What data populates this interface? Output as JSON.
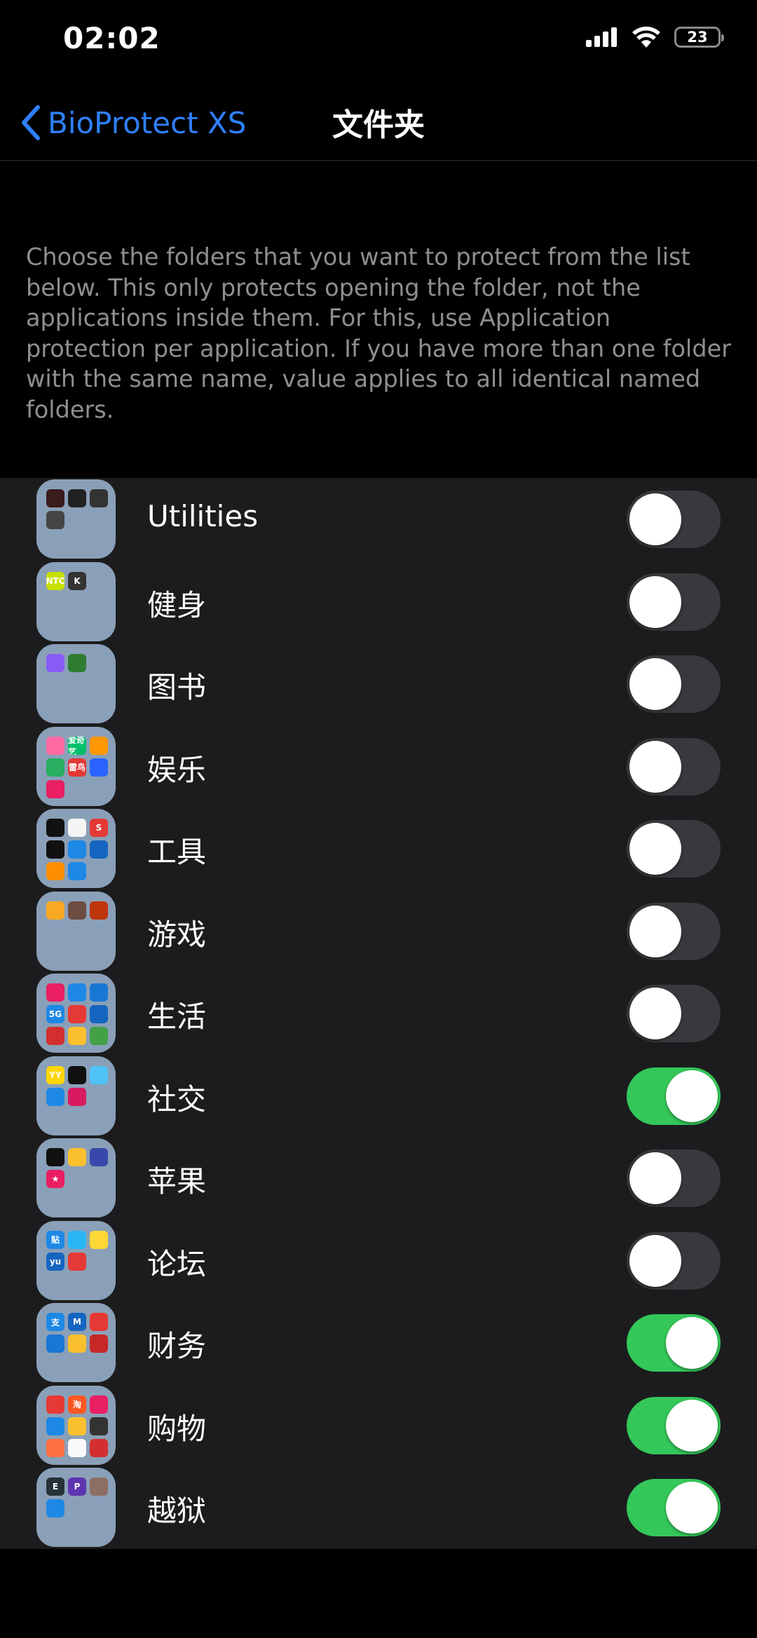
{
  "status_bar": {
    "time": "02:02",
    "battery": "23"
  },
  "nav": {
    "back_label": "BioProtect XS",
    "title": "文件夹"
  },
  "description": "Choose the folders that you want to protect from the list below. This only protects opening the folder, not the applications inside them. For this, use Application protection per application. If you have more than one folder with the same name, value applies to all identical named folders.",
  "colors": {
    "accent": "#2f80ff",
    "toggle_on": "#34c759",
    "toggle_off": "#39393d",
    "list_bg": "#1c1c1e"
  },
  "folders": [
    {
      "label": "Utilities",
      "on": false,
      "apps": [
        {
          "c": "#3a1c1c",
          "t": ""
        },
        {
          "c": "#222",
          "t": ""
        },
        {
          "c": "#333",
          "t": ""
        },
        {
          "c": "#444",
          "t": ""
        }
      ]
    },
    {
      "label": "健身",
      "on": false,
      "apps": [
        {
          "c": "#c8e000",
          "t": "NTC"
        },
        {
          "c": "#333",
          "t": "K"
        }
      ]
    },
    {
      "label": "图书",
      "on": false,
      "apps": [
        {
          "c": "#8a5cf6",
          "t": ""
        },
        {
          "c": "#2e7d32",
          "t": ""
        }
      ]
    },
    {
      "label": "娱乐",
      "on": false,
      "apps": [
        {
          "c": "#ff6aa2",
          "t": ""
        },
        {
          "c": "#00c06b",
          "t": "爱奇艺"
        },
        {
          "c": "#ff9800",
          "t": ""
        },
        {
          "c": "#27ae60",
          "t": ""
        },
        {
          "c": "#e53935",
          "t": "雷鸟"
        },
        {
          "c": "#2962ff",
          "t": ""
        },
        {
          "c": "#e91e63",
          "t": ""
        }
      ]
    },
    {
      "label": "工具",
      "on": false,
      "apps": [
        {
          "c": "#111",
          "t": ""
        },
        {
          "c": "#f5f5f5",
          "t": ""
        },
        {
          "c": "#e53935",
          "t": "S"
        },
        {
          "c": "#111",
          "t": ""
        },
        {
          "c": "#1e88e5",
          "t": ""
        },
        {
          "c": "#1565c0",
          "t": ""
        },
        {
          "c": "#ff8f00",
          "t": ""
        },
        {
          "c": "#1e88e5",
          "t": ""
        }
      ]
    },
    {
      "label": "游戏",
      "on": false,
      "apps": [
        {
          "c": "#f9a825",
          "t": ""
        },
        {
          "c": "#6d4c41",
          "t": ""
        },
        {
          "c": "#bf360c",
          "t": ""
        }
      ]
    },
    {
      "label": "生活",
      "on": false,
      "apps": [
        {
          "c": "#e91e63",
          "t": ""
        },
        {
          "c": "#1e88e5",
          "t": ""
        },
        {
          "c": "#1976d2",
          "t": ""
        },
        {
          "c": "#1e88e5",
          "t": "5G"
        },
        {
          "c": "#e53935",
          "t": ""
        },
        {
          "c": "#1565c0",
          "t": ""
        },
        {
          "c": "#d32f2f",
          "t": ""
        },
        {
          "c": "#fbc02d",
          "t": ""
        },
        {
          "c": "#43a047",
          "t": ""
        }
      ]
    },
    {
      "label": "社交",
      "on": true,
      "apps": [
        {
          "c": "#ffd600",
          "t": "YY"
        },
        {
          "c": "#111",
          "t": ""
        },
        {
          "c": "#4fc3f7",
          "t": ""
        },
        {
          "c": "#1e88e5",
          "t": ""
        },
        {
          "c": "#d81b60",
          "t": ""
        }
      ]
    },
    {
      "label": "苹果",
      "on": false,
      "apps": [
        {
          "c": "#111",
          "t": ""
        },
        {
          "c": "#fbc02d",
          "t": ""
        },
        {
          "c": "#3949ab",
          "t": ""
        },
        {
          "c": "#e91e63",
          "t": "★"
        }
      ]
    },
    {
      "label": "论坛",
      "on": false,
      "apps": [
        {
          "c": "#1e88e5",
          "t": "贴"
        },
        {
          "c": "#29b6f6",
          "t": ""
        },
        {
          "c": "#fdd835",
          "t": ""
        },
        {
          "c": "#1565c0",
          "t": "yu"
        },
        {
          "c": "#e53935",
          "t": ""
        }
      ]
    },
    {
      "label": "财务",
      "on": true,
      "apps": [
        {
          "c": "#1e88e5",
          "t": "支"
        },
        {
          "c": "#1565c0",
          "t": "M"
        },
        {
          "c": "#e53935",
          "t": ""
        },
        {
          "c": "#1976d2",
          "t": ""
        },
        {
          "c": "#fbc02d",
          "t": ""
        },
        {
          "c": "#c62828",
          "t": ""
        }
      ]
    },
    {
      "label": "购物",
      "on": true,
      "apps": [
        {
          "c": "#e53935",
          "t": ""
        },
        {
          "c": "#ff5722",
          "t": "淘"
        },
        {
          "c": "#e91e63",
          "t": ""
        },
        {
          "c": "#1e88e5",
          "t": ""
        },
        {
          "c": "#fbc02d",
          "t": ""
        },
        {
          "c": "#333",
          "t": ""
        },
        {
          "c": "#ff7043",
          "t": ""
        },
        {
          "c": "#fafafa",
          "t": ""
        },
        {
          "c": "#d32f2f",
          "t": ""
        }
      ]
    },
    {
      "label": "越狱",
      "on": true,
      "apps": [
        {
          "c": "#263238",
          "t": "E"
        },
        {
          "c": "#5e35b1",
          "t": "P"
        },
        {
          "c": "#8d6e63",
          "t": ""
        },
        {
          "c": "#1e88e5",
          "t": ""
        }
      ]
    }
  ]
}
